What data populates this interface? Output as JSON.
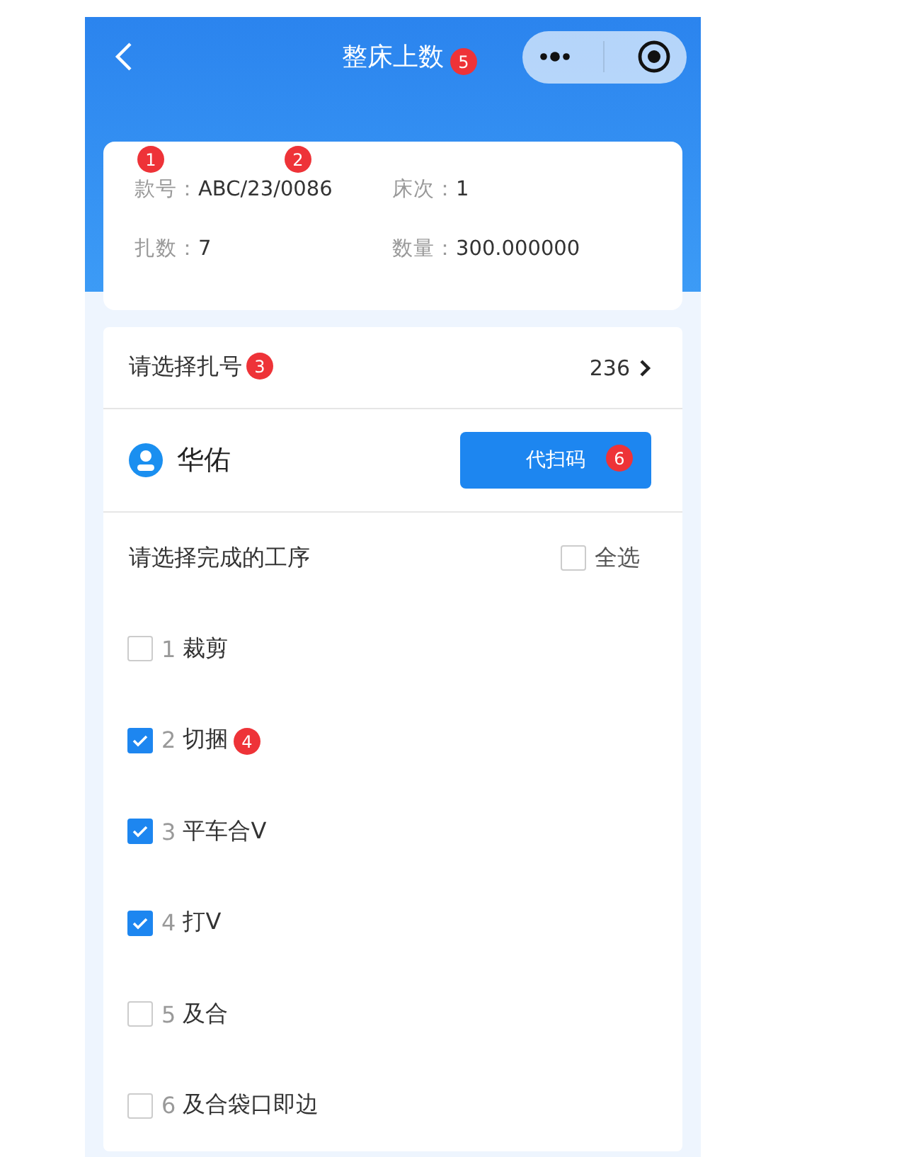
{
  "nav": {
    "title": "整床上数"
  },
  "info": [
    {
      "label": "款号：",
      "value": "ABC/23/0086"
    },
    {
      "label": "床次：",
      "value": "1"
    },
    {
      "label": "扎数：",
      "value": "7"
    },
    {
      "label": "数量：",
      "value": "300.000000"
    }
  ],
  "bundle": {
    "label": "请选择扎号",
    "value": "236"
  },
  "worker": {
    "name": "华佑",
    "button": "代扫码"
  },
  "process": {
    "title": "请选择完成的工序",
    "select_all": {
      "label": "全选",
      "checked": false
    },
    "steps": [
      {
        "index": "1",
        "name": "裁剪",
        "checked": false
      },
      {
        "index": "2",
        "name": "切捆",
        "checked": true
      },
      {
        "index": "3",
        "name": "平车合V",
        "checked": true
      },
      {
        "index": "4",
        "name": "打V",
        "checked": true
      },
      {
        "index": "5",
        "name": "及合",
        "checked": false
      },
      {
        "index": "6",
        "name": "及合袋口即边",
        "checked": false
      }
    ]
  },
  "markers": [
    "1",
    "2",
    "3",
    "4",
    "5",
    "6"
  ]
}
